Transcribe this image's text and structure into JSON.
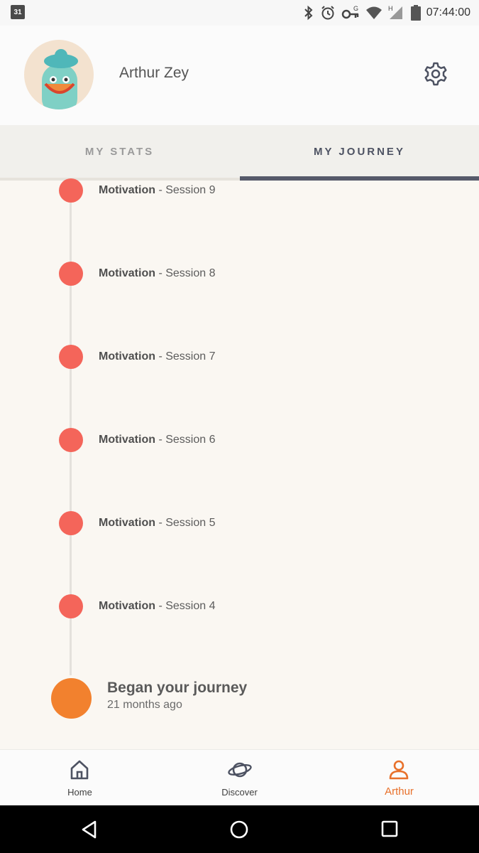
{
  "status_bar": {
    "calendar_day": "31",
    "battery": "82",
    "time": "07:44:00",
    "icons": [
      "bluetooth-icon",
      "alarm-icon",
      "vpn-key-icon",
      "wifi-icon",
      "signal-icon",
      "battery-icon"
    ]
  },
  "profile": {
    "name": "Arthur Zey",
    "avatar": "avatar-character",
    "settings_icon": "gear-icon"
  },
  "tabs": [
    {
      "label": "MY STATS",
      "active": false
    },
    {
      "label": "MY JOURNEY",
      "active": true
    }
  ],
  "timeline": {
    "items": [
      {
        "category": "Motivation",
        "session": " - Session 9"
      },
      {
        "category": "Motivation",
        "session": " - Session 8"
      },
      {
        "category": "Motivation",
        "session": " - Session 7"
      },
      {
        "category": "Motivation",
        "session": " - Session 6"
      },
      {
        "category": "Motivation",
        "session": " - Session 5"
      },
      {
        "category": "Motivation",
        "session": " - Session 4"
      }
    ],
    "start": {
      "title": "Began your journey",
      "subtitle": "21 months ago"
    }
  },
  "bottom_nav": [
    {
      "label": "Home",
      "icon": "home-icon",
      "active": false
    },
    {
      "label": "Discover",
      "icon": "planet-icon",
      "active": false
    },
    {
      "label": "Arthur",
      "icon": "person-icon",
      "active": true
    }
  ],
  "colors": {
    "accent": "#e8702a",
    "session_dot": "#f4655a",
    "begin_dot": "#f2812e",
    "tab_active": "#565a6a",
    "background": "#faf7f2"
  }
}
